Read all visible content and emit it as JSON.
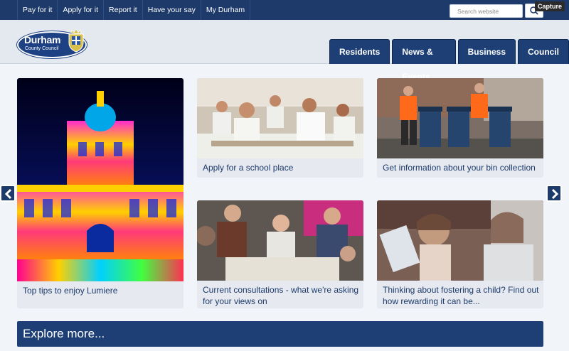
{
  "top_links": [
    "Pay for it",
    "Apply for it",
    "Report it",
    "Have your say",
    "My Durham"
  ],
  "search": {
    "placeholder": "Search website"
  },
  "capture_label": "Capture",
  "logo": {
    "title": "Durham",
    "subtitle": "County Council"
  },
  "main_nav": [
    "Residents",
    "News & Events",
    "Business",
    "Council"
  ],
  "cards": [
    {
      "label": "Top tips to enjoy Lumiere",
      "image": "lumiere-illuminated-building"
    },
    {
      "label": "Apply for a school place",
      "image": "classroom-pupils"
    },
    {
      "label": "Get information about your bin collection",
      "image": "bin-collection-workers"
    },
    {
      "label": "Current consultations - what we're asking for your views on",
      "image": "consultation-meeting"
    },
    {
      "label": "Thinking about fostering a child? Find out how rewarding it can be...",
      "image": "reading-with-child"
    }
  ],
  "carousel": {
    "prev": "chevron-left-icon",
    "next": "chevron-right-icon"
  },
  "explore_label": "Explore more...",
  "colors": {
    "brand": "#1d3a6a",
    "nav": "#1d3f76",
    "background": "#f1f4f8"
  }
}
